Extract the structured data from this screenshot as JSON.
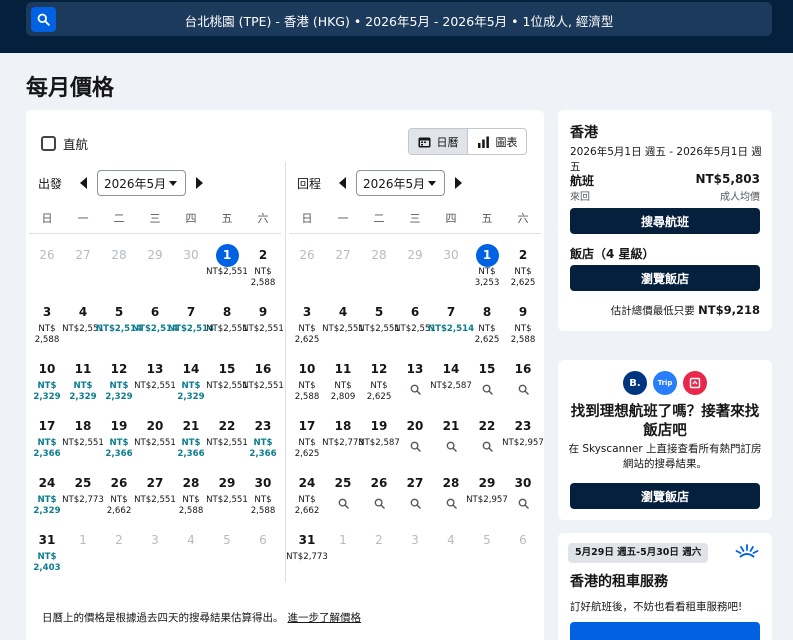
{
  "header": {
    "summary": "台北桃園 (TPE) - 香港 (HKG)  •  2026年5月 - 2026年5月  •  1位成人, 經濟型"
  },
  "page_title": "每月價格",
  "filters": {
    "direct_label": "直航"
  },
  "view_toggle": {
    "calendar_label": "日曆",
    "chart_label": "圖表"
  },
  "weekdays": [
    "日",
    "一",
    "二",
    "三",
    "四",
    "五",
    "六"
  ],
  "outbound": {
    "label": "出發",
    "month": "2026年5月",
    "cells": [
      {
        "d": "26",
        "out": true
      },
      {
        "d": "27",
        "out": true
      },
      {
        "d": "28",
        "out": true
      },
      {
        "d": "29",
        "out": true
      },
      {
        "d": "30",
        "out": true
      },
      {
        "d": "1",
        "sel": true,
        "p": "NT$2,551"
      },
      {
        "d": "2",
        "p": "NT$\n2,588"
      },
      {
        "d": "3",
        "p": "NT$\n2,588"
      },
      {
        "d": "4",
        "p": "NT$2,551"
      },
      {
        "d": "5",
        "p": "NT$2,514",
        "c": true
      },
      {
        "d": "6",
        "p": "NT$2,514",
        "c": true
      },
      {
        "d": "7",
        "p": "NT$2,514",
        "c": true
      },
      {
        "d": "8",
        "p": "NT$2,551"
      },
      {
        "d": "9",
        "p": "NT$2,551"
      },
      {
        "d": "10",
        "p": "NT$\n2,329",
        "c": true
      },
      {
        "d": "11",
        "p": "NT$\n2,329",
        "c": true
      },
      {
        "d": "12",
        "p": "NT$\n2,329",
        "c": true
      },
      {
        "d": "13",
        "p": "NT$2,551"
      },
      {
        "d": "14",
        "p": "NT$\n2,329",
        "c": true
      },
      {
        "d": "15",
        "p": "NT$2,551"
      },
      {
        "d": "16",
        "p": "NT$2,551"
      },
      {
        "d": "17",
        "p": "NT$\n2,366",
        "c": true
      },
      {
        "d": "18",
        "p": "NT$2,551"
      },
      {
        "d": "19",
        "p": "NT$\n2,366",
        "c": true
      },
      {
        "d": "20",
        "p": "NT$2,551"
      },
      {
        "d": "21",
        "p": "NT$\n2,366",
        "c": true
      },
      {
        "d": "22",
        "p": "NT$2,551"
      },
      {
        "d": "23",
        "p": "NT$\n2,366",
        "c": true
      },
      {
        "d": "24",
        "p": "NT$\n2,329",
        "c": true
      },
      {
        "d": "25",
        "p": "NT$2,773"
      },
      {
        "d": "26",
        "p": "NT$\n2,662"
      },
      {
        "d": "27",
        "p": "NT$2,551"
      },
      {
        "d": "28",
        "p": "NT$\n2,588"
      },
      {
        "d": "29",
        "p": "NT$2,551"
      },
      {
        "d": "30",
        "p": "NT$\n2,588"
      },
      {
        "d": "31",
        "p": "NT$\n2,403",
        "c": true
      },
      {
        "d": "1",
        "out": true
      },
      {
        "d": "2",
        "out": true
      },
      {
        "d": "3",
        "out": true
      },
      {
        "d": "4",
        "out": true
      },
      {
        "d": "5",
        "out": true
      },
      {
        "d": "6",
        "out": true
      }
    ]
  },
  "return": {
    "label": "回程",
    "month": "2026年5月",
    "cells": [
      {
        "d": "26",
        "out": true
      },
      {
        "d": "27",
        "out": true
      },
      {
        "d": "28",
        "out": true
      },
      {
        "d": "29",
        "out": true
      },
      {
        "d": "30",
        "out": true
      },
      {
        "d": "1",
        "sel": true,
        "p": "NT$\n3,253"
      },
      {
        "d": "2",
        "p": "NT$\n2,625"
      },
      {
        "d": "3",
        "p": "NT$\n2,625"
      },
      {
        "d": "4",
        "p": "NT$2,551"
      },
      {
        "d": "5",
        "p": "NT$2,551"
      },
      {
        "d": "6",
        "p": "NT$2,551"
      },
      {
        "d": "7",
        "p": "NT$2,514",
        "c": true
      },
      {
        "d": "8",
        "p": "NT$\n2,625"
      },
      {
        "d": "9",
        "p": "NT$\n2,588"
      },
      {
        "d": "10",
        "p": "NT$\n2,588"
      },
      {
        "d": "11",
        "p": "NT$\n2,809"
      },
      {
        "d": "12",
        "p": "NT$\n2,625"
      },
      {
        "d": "13",
        "q": true
      },
      {
        "d": "14",
        "p": "NT$2,587"
      },
      {
        "d": "15",
        "q": true
      },
      {
        "d": "16",
        "q": true
      },
      {
        "d": "17",
        "p": "NT$\n2,625"
      },
      {
        "d": "18",
        "p": "NT$2,773"
      },
      {
        "d": "19",
        "p": "NT$2,587"
      },
      {
        "d": "20",
        "q": true
      },
      {
        "d": "21",
        "q": true
      },
      {
        "d": "22",
        "q": true
      },
      {
        "d": "23",
        "p": "NT$2,957"
      },
      {
        "d": "24",
        "p": "NT$\n2,662"
      },
      {
        "d": "25",
        "q": true
      },
      {
        "d": "26",
        "q": true
      },
      {
        "d": "27",
        "q": true
      },
      {
        "d": "28",
        "q": true
      },
      {
        "d": "29",
        "p": "NT$2,957"
      },
      {
        "d": "30",
        "q": true
      },
      {
        "d": "31",
        "p": "NT$2,773"
      },
      {
        "d": "1",
        "out": true
      },
      {
        "d": "2",
        "out": true
      },
      {
        "d": "3",
        "out": true
      },
      {
        "d": "4",
        "out": true
      },
      {
        "d": "5",
        "out": true
      },
      {
        "d": "6",
        "out": true
      }
    ]
  },
  "disclaimer": {
    "text": "日曆上的價格是根據過去四天的搜尋結果估算得出。",
    "link": "進一步了解價格"
  },
  "summary": {
    "city": "香港",
    "dates": "2026年5月1日 週五 - 2026年5月1日 週五",
    "flight_label": "航班",
    "flight_price": "NT$5,803",
    "trip_type": "來回",
    "price_note": "成人均價",
    "search_flights": "搜尋航班",
    "hotel_label": "飯店（4 星級）",
    "browse_hotels": "瀏覽飯店",
    "total_label": "估計總價最低只要",
    "total_price": "NT$9,218"
  },
  "hotel_promo": {
    "logos": [
      {
        "icon": "booking-logo",
        "text": "B.",
        "color": "#003580"
      },
      {
        "icon": "trip-logo",
        "text": "Trip",
        "color": "#287dfa"
      },
      {
        "icon": "agoda-logo",
        "text": "",
        "color": "#e8284a"
      }
    ],
    "title": "找到理想航班了嗎？接著來找飯店吧",
    "desc": "在 Skyscanner 上直接查看所有熱門訂房網站的搜尋結果。",
    "button": "瀏覽飯店"
  },
  "car_promo": {
    "dates": "5月29日 週五-5月30日 週六",
    "title": "香港的租車服務",
    "desc": "訂好航班後，不妨也看看租車服務吧!"
  },
  "colors": {
    "brand_dark": "#05203c",
    "brand_blue": "#0062e3",
    "cheap": "#0b7d8e"
  }
}
